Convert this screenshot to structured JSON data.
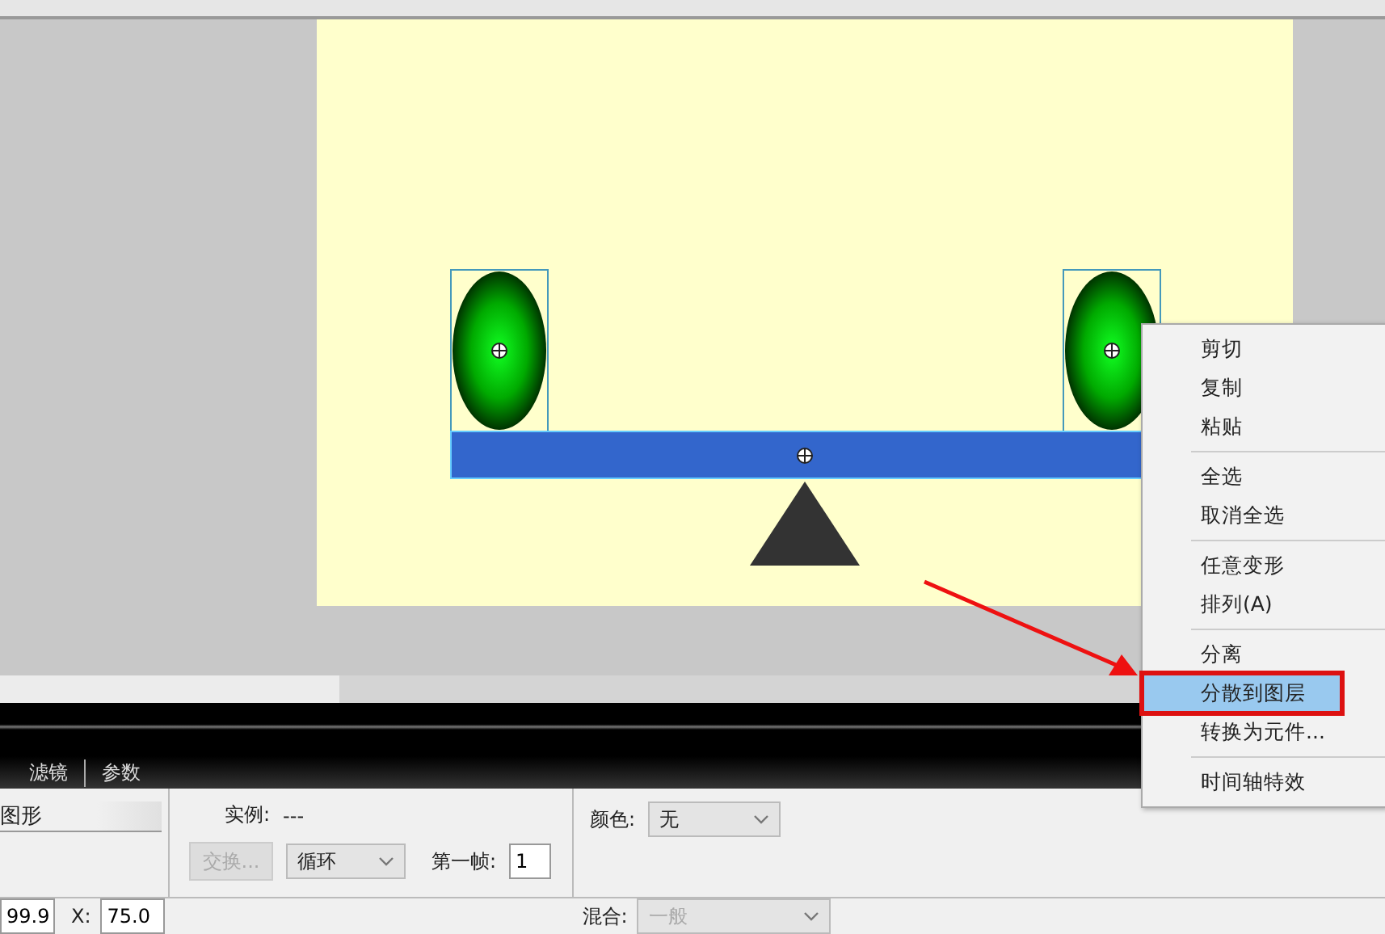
{
  "context_menu": {
    "groups": [
      {
        "items": [
          {
            "label": "剪切",
            "selected": false,
            "annotated": false
          },
          {
            "label": "复制",
            "selected": false,
            "annotated": false
          },
          {
            "label": "粘贴",
            "selected": false,
            "annotated": false
          }
        ]
      },
      {
        "items": [
          {
            "label": "全选",
            "selected": false,
            "annotated": false
          },
          {
            "label": "取消全选",
            "selected": false,
            "annotated": false
          }
        ]
      },
      {
        "items": [
          {
            "label": "任意变形",
            "selected": false,
            "annotated": false
          },
          {
            "label": "排列(A)",
            "selected": false,
            "annotated": false
          }
        ]
      },
      {
        "items": [
          {
            "label": "分离",
            "selected": false,
            "annotated": false
          },
          {
            "label": "分散到图层",
            "selected": true,
            "annotated": true
          },
          {
            "label": "转换为元件...",
            "selected": false,
            "annotated": false
          }
        ]
      },
      {
        "items": [
          {
            "label": "时间轴特效",
            "selected": false,
            "annotated": false
          }
        ]
      }
    ]
  },
  "panel_tabs": [
    {
      "label": "滤镜",
      "selected": false
    },
    {
      "label": "参数",
      "selected": false
    }
  ],
  "properties": {
    "symbol_type": "图形",
    "instance_label": "实例:",
    "instance_value": "---",
    "swap_button": {
      "label": "交换...",
      "disabled": true
    },
    "loop_select": "循环",
    "first_frame_label": "第一帧:",
    "first_frame_value": "1",
    "color_label": "颜色:",
    "color_select": "无",
    "width_value": "99.9",
    "x_label": "X:",
    "x_value": "75.0",
    "blend_label": "混合:",
    "blend_select": {
      "value": "一般",
      "disabled": true
    }
  }
}
